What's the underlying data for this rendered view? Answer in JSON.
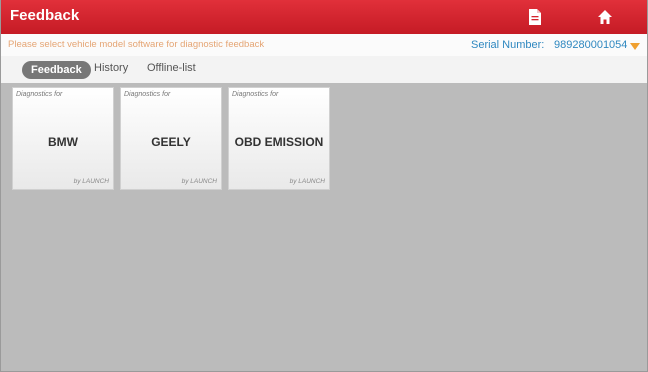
{
  "header": {
    "title": "Feedback",
    "report_icon": "document-icon",
    "home_icon": "home-icon"
  },
  "subbar": {
    "hint": "Please select vehicle model software for diagnostic feedback",
    "serial_label": "Serial Number:",
    "serial_value": "989280001054"
  },
  "tabs": [
    {
      "label": "Feedback",
      "active": true
    },
    {
      "label": "History",
      "active": false
    },
    {
      "label": "Offline-list",
      "active": false
    }
  ],
  "cards": [
    {
      "caption": "Diagnostics for",
      "name": "BMW",
      "brand": "by LAUNCH"
    },
    {
      "caption": "Diagnostics for",
      "name": "GEELY",
      "brand": "by LAUNCH"
    },
    {
      "caption": "Diagnostics for",
      "name": "OBD EMISSION",
      "brand": "by LAUNCH"
    }
  ],
  "colors": {
    "header_red": "#d4232d",
    "serial_blue": "#2f88c0",
    "hint_orange": "#e5a574",
    "caret_orange": "#f0a030",
    "workspace_gray": "#bbbbbb"
  }
}
